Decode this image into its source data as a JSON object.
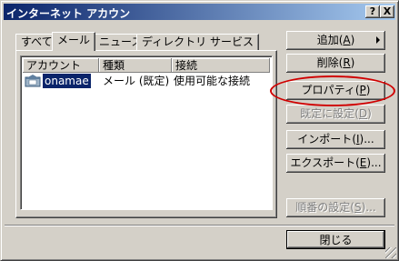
{
  "window": {
    "title": "インターネット アカウン",
    "help_label": "?",
    "close_label": "X"
  },
  "tabs": [
    {
      "label": "すべて"
    },
    {
      "label": "メール",
      "active": true
    },
    {
      "label": "ニュース"
    },
    {
      "label": "ディレクトリ サービス"
    }
  ],
  "list": {
    "columns": [
      "アカウント",
      "種類",
      "接続"
    ],
    "rows": [
      {
        "account": "onamae",
        "type": "メール (既定)",
        "connection": "使用可能な接続",
        "selected": true,
        "icon": "mail-account-icon"
      }
    ]
  },
  "buttons": {
    "add": {
      "label": "追加",
      "key": "A",
      "suffix": ")"
    },
    "remove": {
      "label": "削除",
      "key": "R"
    },
    "properties": {
      "label": "プロパティ",
      "key": "P"
    },
    "set_default": {
      "label": "既定に設定",
      "key": "D"
    },
    "import": {
      "label": "インポート",
      "key": "I",
      "ellipsis": "..."
    },
    "export": {
      "label": "エクスポート",
      "key": "E",
      "ellipsis": "..."
    },
    "order": {
      "label": "順番の設定",
      "key": "S",
      "ellipsis": "..."
    },
    "close": {
      "label": "閉じる"
    }
  },
  "colors": {
    "highlight_circle": "#d00000",
    "title_bar": "#0a246a",
    "selection": "#0a246a"
  }
}
